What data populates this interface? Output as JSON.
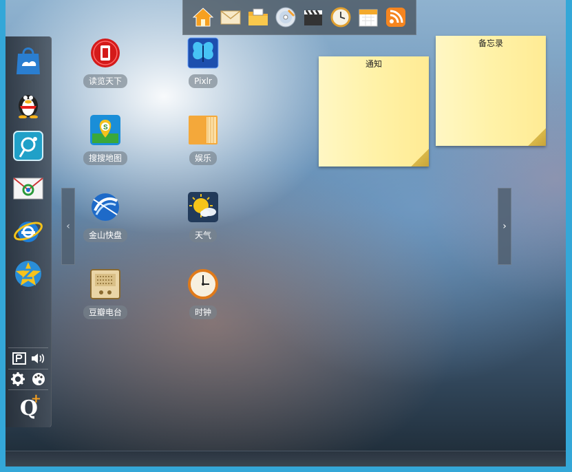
{
  "top_dock": {
    "icons": [
      "home-icon",
      "mail-icon",
      "folder-icon",
      "cd-icon",
      "clapper-icon",
      "clock-icon",
      "calendar-icon",
      "rss-icon"
    ]
  },
  "sidebar": {
    "apps": [
      "app-store-icon",
      "qq-penguin-icon",
      "qq-map-icon",
      "qq-mail-icon",
      "ie-browser-icon",
      "qzone-icon"
    ],
    "tools": [
      "pin-icon",
      "volume-icon",
      "settings-gear-icon",
      "palette-icon"
    ],
    "q_logo": "Q"
  },
  "apps": [
    {
      "label": "读览天下",
      "icon": "reader-icon",
      "color": "#d81e1e"
    },
    {
      "label": "Pixlr",
      "icon": "pixlr-butterfly-icon",
      "color": "#2a5fb8"
    },
    {
      "label": "搜搜地图",
      "icon": "soso-map-icon",
      "color": "#1a8ed8"
    },
    {
      "label": "娱乐",
      "icon": "folder-icon",
      "color": "#f4a83a"
    },
    {
      "label": "金山快盘",
      "icon": "kuaipan-icon",
      "color": "#1e6ac8"
    },
    {
      "label": "天气",
      "icon": "weather-icon",
      "color": "#f0c020"
    },
    {
      "label": "豆瓣电台",
      "icon": "douban-radio-icon",
      "color": "#e8d2a0"
    },
    {
      "label": "时钟",
      "icon": "clock-icon",
      "color": "#e07a1a"
    }
  ],
  "notes": [
    {
      "title": "通知"
    },
    {
      "title": "备忘录"
    }
  ],
  "pager": {
    "prev": "‹",
    "next": "›"
  }
}
